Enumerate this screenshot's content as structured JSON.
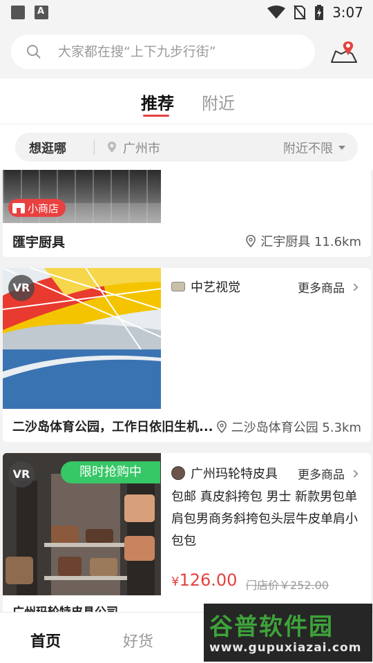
{
  "status_bar": {
    "left_icons": [
      "image-icon",
      "font-icon"
    ],
    "right_icons": [
      "wifi-icon",
      "no-sim-icon",
      "battery-charging-icon"
    ],
    "time": "3:07"
  },
  "search": {
    "placeholder": "大家都在搜“上下九步行街”"
  },
  "tabs": [
    {
      "label": "推荐",
      "active": true
    },
    {
      "label": "附近",
      "active": false
    }
  ],
  "filter": {
    "label": "想逛哪",
    "city": "广州市",
    "range": "附近不限"
  },
  "cards": [
    {
      "badge": "小商店",
      "name": "匯宇厨具",
      "location": "汇宇厨具 11.6km"
    },
    {
      "vr": "VR",
      "store_name": "中艺视觉",
      "more": "更多商品",
      "name": "二沙岛体育公园，工作日依旧生机...",
      "location": "二沙岛体育公园 5.3km"
    },
    {
      "vr": "VR",
      "promo": "限时抢购中",
      "store_name": "广州玛轮特皮具",
      "more": "更多商品",
      "product_title": "包邮 真皮斜挎包 男士 新款男包单肩包男商务斜挎包头层牛皮单肩小包包",
      "price_symbol": "¥",
      "price": "126.00",
      "original_price": "门店价￥252.00",
      "name": "广州玛轮特皮具公司"
    }
  ],
  "bottom_nav": [
    {
      "label": "首页",
      "active": true
    },
    {
      "label": "好货",
      "active": false
    }
  ],
  "watermark": {
    "title": "谷普软件园",
    "url": "www.gupuxiazai.com"
  },
  "colors": {
    "accent_red": "#e5413f",
    "promo_green": "#36c766"
  }
}
